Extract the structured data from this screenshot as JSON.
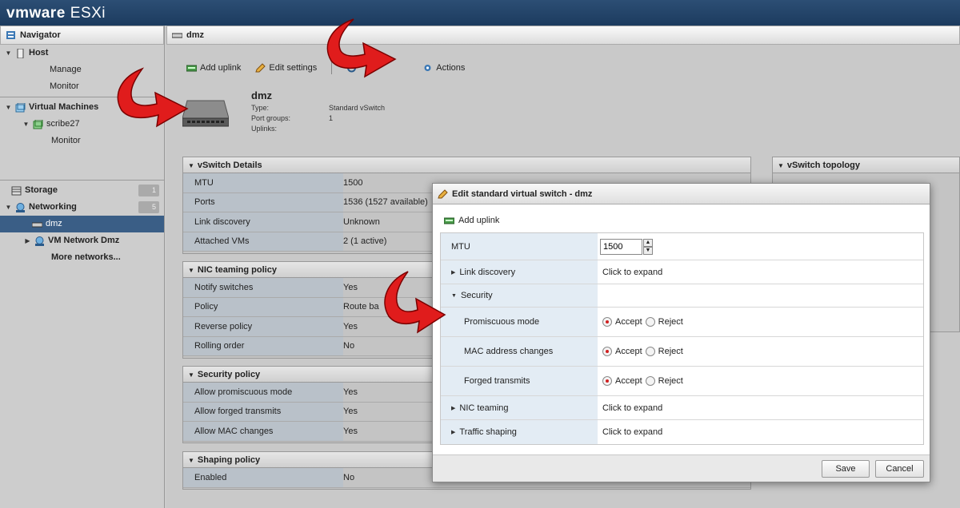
{
  "app": {
    "brand": "vmware",
    "product": "ESXi"
  },
  "navigator": {
    "title": "Navigator",
    "items": [
      {
        "label": "Host",
        "level": 0,
        "expanded": true
      },
      {
        "label": "Manage",
        "level": 1
      },
      {
        "label": "Monitor",
        "level": 1
      },
      {
        "label": "Virtual Machines",
        "level": 0,
        "expanded": true
      },
      {
        "label": "scribe27",
        "level": 1,
        "expanded": true
      },
      {
        "label": "Monitor",
        "level": 2
      },
      {
        "label": "Storage",
        "level": 0,
        "count": "1"
      },
      {
        "label": "Networking",
        "level": 0,
        "count": "5",
        "expanded": true
      },
      {
        "label": "dmz",
        "level": 1,
        "selected": true
      },
      {
        "label": "VM Network Dmz",
        "level": 1
      },
      {
        "label": "More networks...",
        "level": 2
      }
    ]
  },
  "main": {
    "title": "dmz",
    "toolbar": {
      "add_uplink": "Add uplink",
      "edit_settings": "Edit settings",
      "actions": "Actions"
    },
    "switch": {
      "name": "dmz",
      "type_label": "Type:",
      "type_value": "Standard vSwitch",
      "portgroups_label": "Port groups:",
      "portgroups_value": "1",
      "uplinks_label": "Uplinks:",
      "uplinks_value": ""
    },
    "vswitch_details": {
      "title": "vSwitch Details",
      "rows": [
        {
          "k": "MTU",
          "v": "1500"
        },
        {
          "k": "Ports",
          "v": "1536 (1527 available)"
        },
        {
          "k": "Link discovery",
          "v": "Unknown"
        },
        {
          "k": "Attached VMs",
          "v": "2 (1 active)"
        }
      ]
    },
    "nic_teaming": {
      "title": "NIC teaming policy",
      "rows": [
        {
          "k": "Notify switches",
          "v": "Yes"
        },
        {
          "k": "Policy",
          "v": "Route ba"
        },
        {
          "k": "Reverse policy",
          "v": "Yes"
        },
        {
          "k": "Rolling order",
          "v": "No"
        }
      ]
    },
    "security_policy": {
      "title": "Security policy",
      "rows": [
        {
          "k": "Allow promiscuous mode",
          "v": "Yes"
        },
        {
          "k": "Allow forged transmits",
          "v": "Yes"
        },
        {
          "k": "Allow MAC changes",
          "v": "Yes"
        }
      ]
    },
    "shaping_policy": {
      "title": "Shaping policy",
      "rows": [
        {
          "k": "Enabled",
          "v": "No"
        }
      ]
    },
    "topology": {
      "title": "vSwitch topology"
    }
  },
  "dialog": {
    "title": "Edit standard virtual switch - dmz",
    "add_uplink": "Add uplink",
    "mtu_label": "MTU",
    "mtu_value": "1500",
    "link_discovery_label": "Link discovery",
    "link_discovery_value": "Click to expand",
    "security_label": "Security",
    "promiscuous_label": "Promiscuous mode",
    "mac_label": "MAC address changes",
    "forged_label": "Forged transmits",
    "accept": "Accept",
    "reject": "Reject",
    "nic_teaming_label": "NIC teaming",
    "nic_teaming_value": "Click to expand",
    "traffic_label": "Traffic shaping",
    "traffic_value": "Click to expand",
    "save": "Save",
    "cancel": "Cancel"
  },
  "colors": {
    "accent": "#1c3b5f",
    "selected_nav": "#3a5e86",
    "annotation_arrow": "#e02020",
    "radio_on": "#d02020"
  }
}
